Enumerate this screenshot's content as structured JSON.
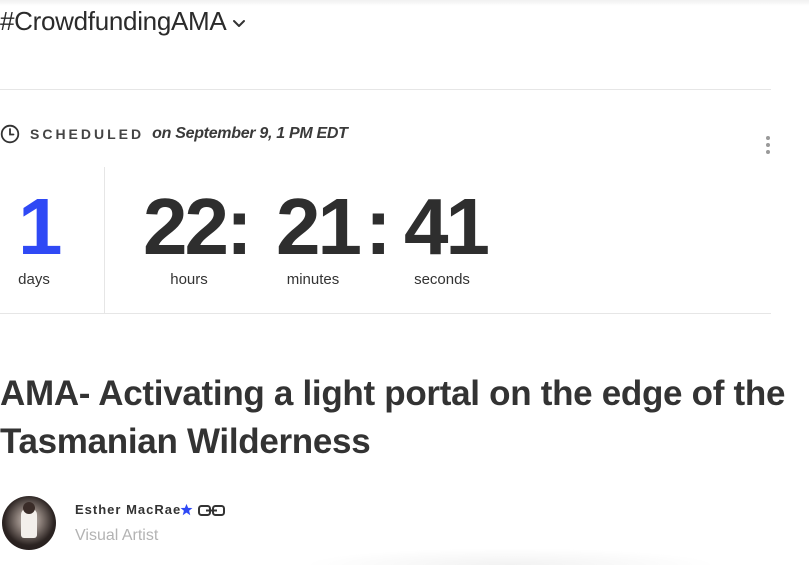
{
  "header": {
    "hashtag": "#CrowdfundingAMA"
  },
  "schedule": {
    "label": "SCHEDULED",
    "date_text": "on September 9, 1 PM EDT"
  },
  "countdown": {
    "days": {
      "value": "1",
      "label": "days"
    },
    "hours": {
      "value": "22:",
      "label": "hours"
    },
    "minutes": {
      "value": "21",
      "label": "minutes"
    },
    "separator": ":",
    "seconds": {
      "value": "41",
      "label": "seconds"
    }
  },
  "event": {
    "title": "AMA- Activating a light portal on the edge of the Tasmanian Wilderness"
  },
  "author": {
    "name": "Esther MacRae",
    "role": "Visual Artist"
  },
  "colors": {
    "accent": "#2f49f5",
    "text": "#333333",
    "muted": "#b3b3b3"
  },
  "icons": {
    "chevron": "chevron-down-icon",
    "clock": "clock-icon",
    "menu": "more-vertical-icon",
    "verified": "star-icon",
    "link": "link-icon"
  }
}
